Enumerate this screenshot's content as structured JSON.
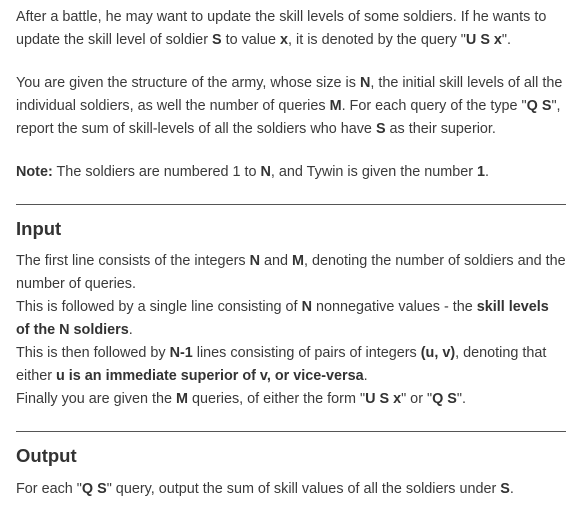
{
  "intro": {
    "p1_a": "After a battle, he may want to update the skill levels of some soldiers. If he wants to update the skill level of soldier ",
    "p1_b": "S",
    "p1_c": " to value ",
    "p1_d": "x",
    "p1_e": ", it is denoted by the query \"",
    "p1_f": "U S x",
    "p1_g": "\".",
    "p2_a": "You are given the structure of the army, whose size is ",
    "p2_b": "N",
    "p2_c": ", the initial skill levels of all the individual soldiers, as well the number of queries ",
    "p2_d": "M",
    "p2_e": ". For each query of the type \"",
    "p2_f": "Q S",
    "p2_g": "\", report the sum of skill-levels of all the soldiers who have ",
    "p2_h": "S",
    "p2_i": " as their superior.",
    "note_label": "Note:",
    "note_a": " The soldiers are numbered 1 to ",
    "note_b": "N",
    "note_c": ", and Tywin is given the number ",
    "note_d": "1",
    "note_e": "."
  },
  "input_section": {
    "heading": "Input",
    "l1_a": "The first line consists of the integers ",
    "l1_b": "N",
    "l1_c": " and ",
    "l1_d": "M",
    "l1_e": ", denoting the number of soldiers and the number of queries.",
    "l2_a": "This is followed by a single line consisting of ",
    "l2_b": "N",
    "l2_c": " nonnegative values - the ",
    "l2_d": "skill levels of the N soldiers",
    "l2_e": ".",
    "l3_a": "This is then followed by ",
    "l3_b": "N-1",
    "l3_c": " lines consisting of pairs of integers ",
    "l3_d": "(u, v)",
    "l3_e": ", denoting that either ",
    "l3_f": "u is an immediate superior of v, or vice-versa",
    "l3_g": ".",
    "l4_a": "Finally you are given the ",
    "l4_b": "M",
    "l4_c": " queries, of either the form \"",
    "l4_d": "U S x",
    "l4_e": "\" or \"",
    "l4_f": "Q S",
    "l4_g": "\"."
  },
  "output_section": {
    "heading": "Output",
    "o1_a": "For each \"",
    "o1_b": "Q S",
    "o1_c": "\" query, output the sum of skill values of all the soldiers under ",
    "o1_d": "S",
    "o1_e": "."
  }
}
